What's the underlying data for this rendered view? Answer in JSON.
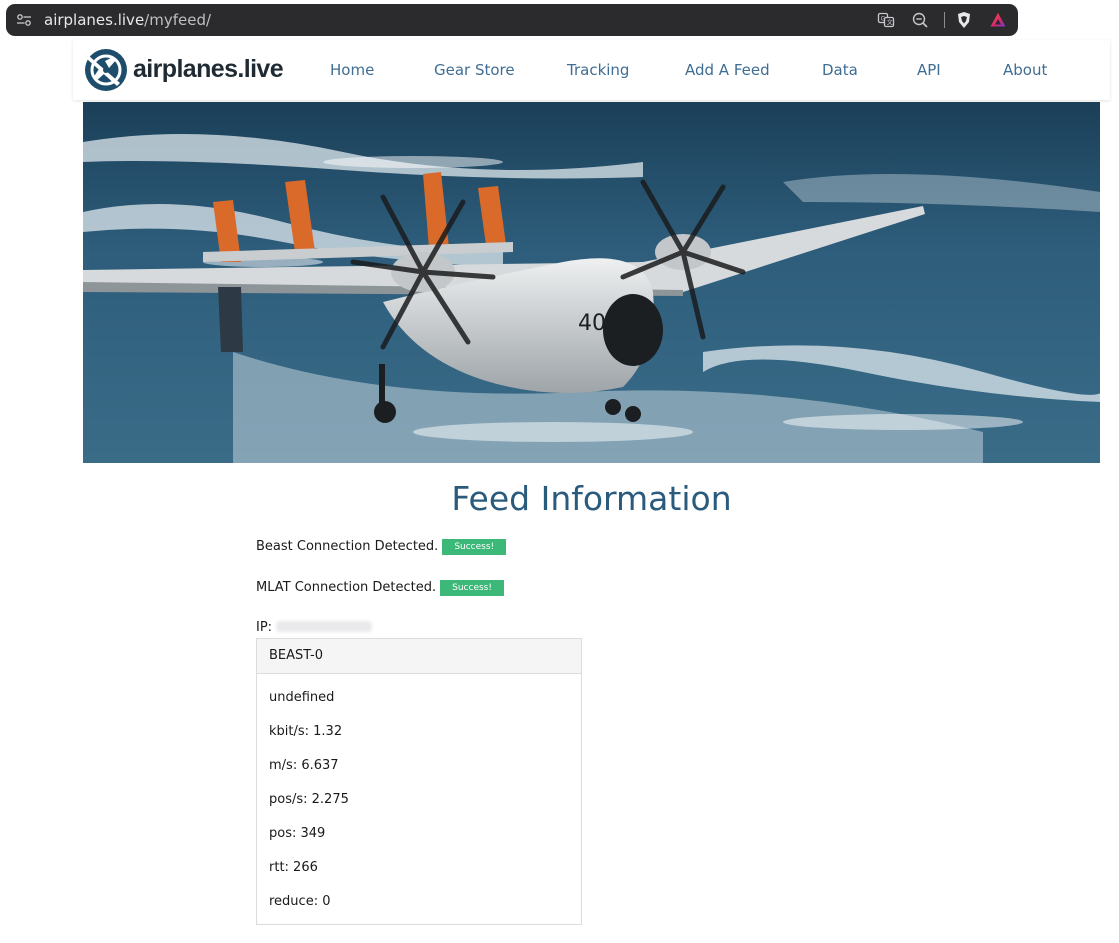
{
  "browser": {
    "url_host": "airplanes.live",
    "url_path": "/myfeed/"
  },
  "site": {
    "logo_text": "airplanes.live",
    "nav": [
      "Home",
      "Gear Store",
      "Tracking",
      "Add A Feed",
      "Data",
      "API",
      "About"
    ]
  },
  "feed": {
    "title": "Feed Information",
    "beast_status": "Beast Connection Detected.",
    "beast_badge": "Success!",
    "mlat_status": "MLAT Connection Detected.",
    "mlat_badge": "Success!",
    "ip_label": "IP:",
    "card_title": "BEAST-0",
    "stats": [
      "undefined",
      "kbit/s: 1.32",
      "m/s: 6.637",
      "pos/s: 2.275",
      "pos: 349",
      "rtt: 266",
      "reduce: 0"
    ]
  },
  "colors": {
    "nav_link": "#3f6d94",
    "title": "#2a5b7d",
    "badge": "#3cb878",
    "logo_blue": "#1e4d6b"
  },
  "hero": {
    "aircraft_text": "40"
  }
}
